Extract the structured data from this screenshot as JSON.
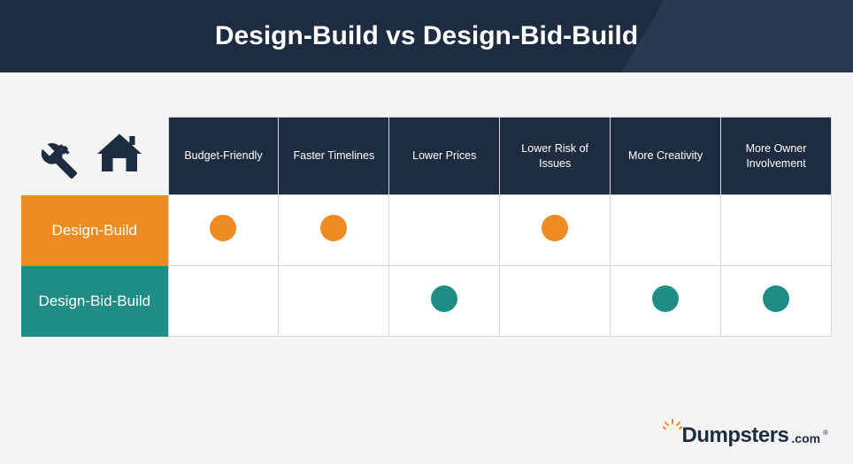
{
  "header": {
    "title": "Design-Build vs Design-Bid-Build"
  },
  "columns": [
    "Budget-Friendly",
    "Faster Timelines",
    "Lower Prices",
    "Lower Risk of Issues",
    "More Creativity",
    "More Owner Involvement"
  ],
  "rows": [
    {
      "label": "Design-Build",
      "color": "orange",
      "marks": [
        true,
        true,
        false,
        true,
        false,
        false
      ]
    },
    {
      "label": "Design-Bid-Build",
      "color": "teal",
      "marks": [
        false,
        false,
        true,
        false,
        true,
        true
      ]
    }
  ],
  "logo": {
    "brand": "Dumpsters",
    "suffix": ".com",
    "reg": "®"
  },
  "chart_data": {
    "type": "table",
    "title": "Design-Build vs Design-Bid-Build",
    "categories": [
      "Budget-Friendly",
      "Faster Timelines",
      "Lower Prices",
      "Lower Risk of Issues",
      "More Creativity",
      "More Owner Involvement"
    ],
    "series": [
      {
        "name": "Design-Build",
        "values": [
          1,
          1,
          0,
          1,
          0,
          0
        ]
      },
      {
        "name": "Design-Bid-Build",
        "values": [
          0,
          0,
          1,
          0,
          1,
          1
        ]
      }
    ]
  }
}
